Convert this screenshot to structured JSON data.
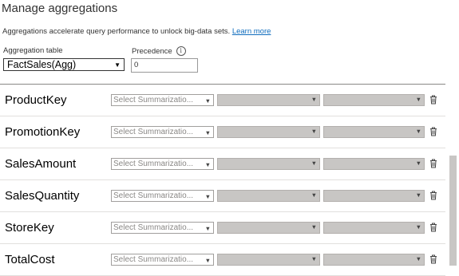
{
  "header": {
    "title": "Manage aggregations",
    "subtitle": "Aggregations accelerate query performance to unlock big-data sets.",
    "learn_more": "Learn more"
  },
  "aggregation_table": {
    "label": "Aggregation table",
    "value": "FactSales(Agg)"
  },
  "precedence": {
    "label": "Precedence",
    "value": "0"
  },
  "summarization_placeholder": "Select Summarizatio...",
  "rows": [
    {
      "name": "ProductKey"
    },
    {
      "name": "PromotionKey"
    },
    {
      "name": "SalesAmount"
    },
    {
      "name": "SalesQuantity"
    },
    {
      "name": "StoreKey"
    },
    {
      "name": "TotalCost"
    }
  ],
  "icons": {
    "info": "info-icon",
    "delete": "trash-icon",
    "dropdown": "chevron-down-icon"
  }
}
